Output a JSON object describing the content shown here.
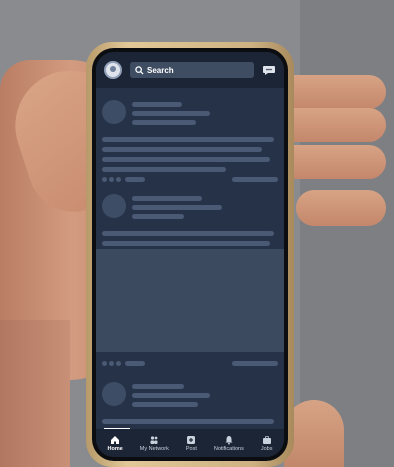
{
  "search": {
    "label": "Search"
  },
  "icons": {
    "search": "search-icon",
    "messages": "chat-icon",
    "home": "home-icon",
    "network": "people-icon",
    "post": "plus-square-icon",
    "notifications": "bell-icon",
    "jobs": "briefcase-icon"
  },
  "nav": {
    "home": "Home",
    "network": "My Network",
    "post": "Post",
    "notifications": "Notifications",
    "jobs": "Jobs"
  },
  "colors": {
    "screen_bg": "#263247",
    "bar": "#4b5a74",
    "frame": "#d7bc8c"
  }
}
